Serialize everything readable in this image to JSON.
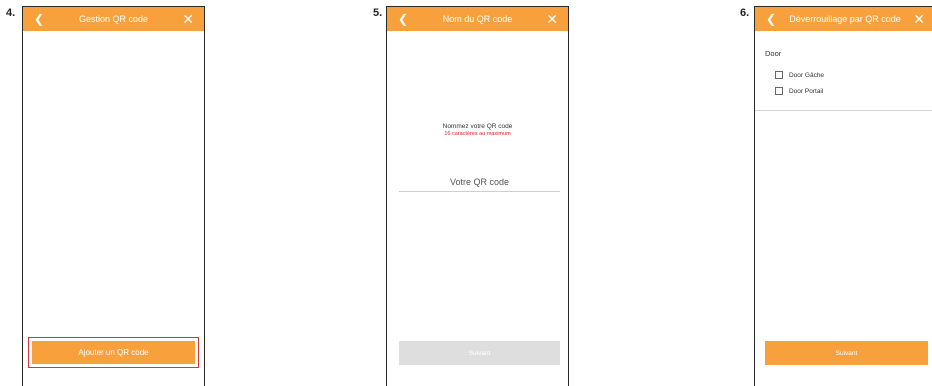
{
  "screens": [
    {
      "step": "4.",
      "title": "Gestion QR code",
      "back_icon": "chevron-left",
      "close_icon": "close-x",
      "add_button": "Ajouter un QR code"
    },
    {
      "step": "5.",
      "title": "Nom du QR code",
      "back_icon": "chevron-left",
      "close_icon": "close-x",
      "prompt": "Nommez votre QR code",
      "hint": "16 caractères au maximum",
      "input_placeholder": "Votre QR code",
      "next_button": "Suivant"
    },
    {
      "step": "6.",
      "title": "Déverrouillage par QR code",
      "back_icon": "chevron-left",
      "close_icon": "close-x",
      "section_label": "Door",
      "options": [
        "Door Gâche",
        "Door Portail"
      ],
      "next_button": "Suivant"
    }
  ],
  "colors": {
    "accent": "#f7a03c",
    "highlight_border": "#d8343b",
    "hint_red": "#e02020",
    "disabled_button": "#dedede"
  }
}
